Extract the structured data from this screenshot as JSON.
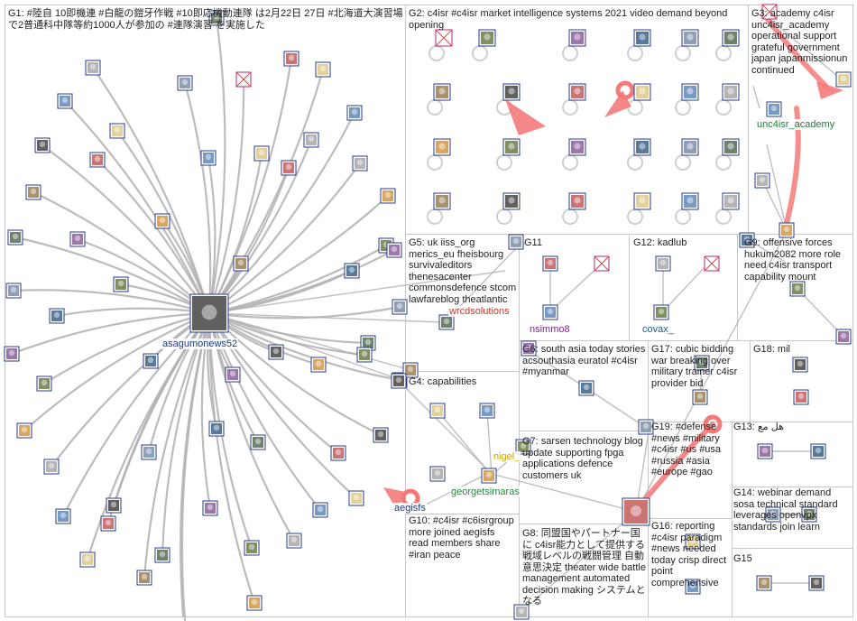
{
  "groups": [
    {
      "id": "G1",
      "text": "G1: #陸自 10即機連 #白龍の鎧牙作戦 #10即応機動連隊 は2月22日 27日 #北海道大演習場 で2普通科中隊等約1000人が参加の #連隊演習 を実施した"
    },
    {
      "id": "G2",
      "text": "G2: c4isr #c4isr market intelligence systems 2021 video demand beyond opening"
    },
    {
      "id": "G3",
      "text": "G3: academy c4isr unc4isr_academy operational support grateful government japan japanmissionun continued"
    },
    {
      "id": "G4",
      "text": "G4: capabilities"
    },
    {
      "id": "G5",
      "text": "G5: uk iiss_org merics_eu fheisbourg survivaleditors thenesacenter commonsdefence stcom lawfareblog theatlantic"
    },
    {
      "id": "G6",
      "text": "G6: south asia today stories acsouthasia euratol #c4isr #myanmar"
    },
    {
      "id": "G7",
      "text": "G7: sarsen technology blog update supporting fpga applications defence customers uk"
    },
    {
      "id": "G8",
      "text": "G8: 同盟国やパートナー国に c4isr能力として提供する戦域レベルの戦闘管理 自動意思決定 theater wide battle management automated decision making システムとなる"
    },
    {
      "id": "G9",
      "text": "G9: offensive forces hukum2082 more role need c4isr transport capability mount"
    },
    {
      "id": "G10",
      "text": "G10: #c4isr #c6isrgroup more joined aegisfs read members share #iran peace"
    },
    {
      "id": "G11",
      "text": "G11"
    },
    {
      "id": "G12",
      "text": "G12: kadlub"
    },
    {
      "id": "G13",
      "text": "G13: هل مع"
    },
    {
      "id": "G14",
      "text": "G14: webinar demand sosa technical standard leverages openvpx standards join learn"
    },
    {
      "id": "G15",
      "text": "G15"
    },
    {
      "id": "G16",
      "text": "G16: reporting #c4isr paradigm #news needed today crisp direct point comprehensive"
    },
    {
      "id": "G17",
      "text": "G17: cubic bidding war breaking over military trainer c4isr provider bid"
    },
    {
      "id": "G18",
      "text": "G18: mil"
    },
    {
      "id": "G19",
      "text": "G19: #defense #news #military #c4isr #us #usa #russia #asia #europe #gao"
    }
  ],
  "node_labels": [
    {
      "id": "asagumonews52",
      "text": "asagumonews52",
      "color": "#1f3f7a"
    },
    {
      "id": "unc4isr_academy",
      "text": "unc4isr_academy",
      "color": "#1e7b3a"
    },
    {
      "id": "wrcdsolutions",
      "text": "wrcdsolutions",
      "color": "#c0392b"
    },
    {
      "id": "nsimmo8",
      "text": "nsimmo8",
      "color": "#7a2a8a"
    },
    {
      "id": "covax_",
      "text": "covax_",
      "color": "#1e5a8a"
    },
    {
      "id": "georgetsimaras",
      "text": "georgetsimaras",
      "color": "#1e8a3a"
    },
    {
      "id": "nigel",
      "text": "nigel_",
      "color": "#c9a400"
    },
    {
      "id": "aegisfs",
      "text": "aegisfs",
      "color": "#1f3f7a"
    }
  ],
  "colors": {
    "frame": "#c8c8c8",
    "edge_gray": "#b0b0b0",
    "edge_red": "#f47a7a",
    "text": "#222222"
  }
}
